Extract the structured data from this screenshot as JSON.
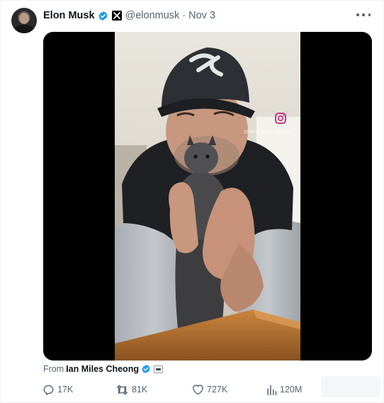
{
  "author": {
    "name": "Elon Musk",
    "handle": "@elonmusk",
    "separator": "·",
    "date": "Nov 3"
  },
  "icons": {
    "avatar": "avatar",
    "verified": "verified-badge-icon",
    "affiliate": "x-affiliate-icon",
    "more": "more-options-icon",
    "reply": "reply-icon",
    "repost": "repost-icon",
    "like": "heart-icon",
    "views": "views-icon",
    "instagram": "instagram-icon"
  },
  "media": {
    "type": "video-thumbnail",
    "overlay_text": "@iancheong_squirrel"
  },
  "source": {
    "prefix": "From",
    "name": "Ian Miles Cheong"
  },
  "metrics": {
    "replies": "17K",
    "reposts": "81K",
    "likes": "727K",
    "views": "120M"
  },
  "colors": {
    "verified": "#1d9bf0",
    "secondary_text": "#536471",
    "primary_text": "#0f1419",
    "media_background": "#000000"
  }
}
